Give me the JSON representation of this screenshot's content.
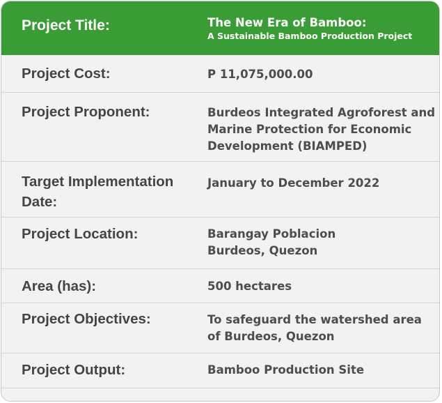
{
  "header": {
    "label": "Project Title:",
    "title_line1": "The New Era of Bamboo:",
    "title_line2": "A Sustainable Bamboo Production Project"
  },
  "rows": [
    {
      "label": "Project Cost:",
      "value_lines": [
        "P 11,075,000.00"
      ]
    },
    {
      "label": "Project Proponent:",
      "value_lines": [
        "Burdeos Integrated Agroforest and",
        "Marine Protection for Economic",
        "Development (BIAMPED)"
      ]
    },
    {
      "label_lines": [
        "Target Implementation",
        "Date:"
      ],
      "value_lines": [
        "January to December 2022"
      ]
    },
    {
      "label": "Project Location:",
      "value_lines": [
        "Barangay Poblacion",
        "Burdeos, Quezon"
      ]
    },
    {
      "label": "Area (has):",
      "value_lines": [
        "500 hectares"
      ]
    },
    {
      "label": "Project Objectives:",
      "value_lines": [
        "To safeguard the watershed area",
        "of Burdeos, Quezon"
      ]
    },
    {
      "label": "Project Output:",
      "value_lines": [
        "Bamboo Production Site"
      ]
    }
  ],
  "colors": {
    "header_bg": "#3a9c34",
    "row_bg": "#f2f2f2",
    "text": "#444444"
  }
}
